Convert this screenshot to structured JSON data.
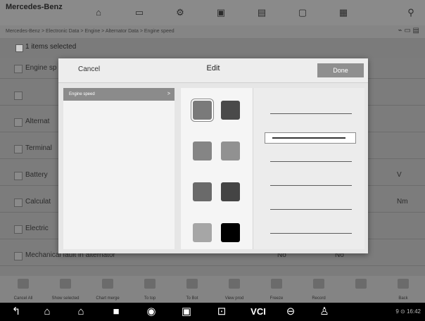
{
  "app": {
    "brand": "Mercedes-Benz",
    "sub": ""
  },
  "breadcrumb": "Mercedes-Benz > Electronic Data > Engine > Alternator Data > Engine speed",
  "selection": {
    "label": "1 items selected"
  },
  "background_rows": [
    {
      "name": "Engine sp",
      "v1": "",
      "v2": "",
      "unit": ""
    },
    {
      "name": "",
      "v1": "",
      "v2": "",
      "unit": ""
    },
    {
      "name": "Alternat",
      "v1": "",
      "v2": "",
      "unit": ""
    },
    {
      "name": "Terminal",
      "v1": "",
      "v2": "",
      "unit": ""
    },
    {
      "name": "Battery",
      "v1": "",
      "v2": "",
      "unit": "V"
    },
    {
      "name": "Calculat",
      "v1": "",
      "v2": "",
      "unit": "Nm"
    },
    {
      "name": "Electric",
      "v1": "",
      "v2": "",
      "unit": ""
    },
    {
      "name": "Mechanical fault in alternator",
      "v1": "No",
      "v2": "No",
      "unit": ""
    }
  ],
  "toolbar": [
    {
      "label": "Cancel All"
    },
    {
      "label": "Show selected"
    },
    {
      "label": "Chart merge"
    },
    {
      "label": "To top"
    },
    {
      "label": "To Bot"
    },
    {
      "label": "View prod"
    },
    {
      "label": "Freeze"
    },
    {
      "label": "Record"
    },
    {
      "label": ""
    },
    {
      "label": "Back"
    }
  ],
  "status": {
    "clock": "9 ⊙ 16:42"
  },
  "modal": {
    "title": "Edit",
    "cancel_label": "Cancel",
    "done_label": "Done",
    "items": [
      {
        "label": "Engine speed",
        "arrow": ">"
      }
    ],
    "swatches": [
      {
        "color": "#7a7a7a",
        "selected": true
      },
      {
        "color": "#4a4a4a",
        "selected": false
      },
      {
        "color": "#858585",
        "selected": false
      },
      {
        "color": "#919191",
        "selected": false
      },
      {
        "color": "#6a6a6a",
        "selected": false
      },
      {
        "color": "#444444",
        "selected": false
      },
      {
        "color": "#a6a6a6",
        "selected": false
      },
      {
        "color": "#000000",
        "selected": false
      }
    ],
    "line_styles": [
      {
        "style": "thin",
        "selected": false
      },
      {
        "style": "thick",
        "selected": true
      },
      {
        "style": "thin",
        "selected": false
      },
      {
        "style": "thin",
        "selected": false
      },
      {
        "style": "thin",
        "selected": false
      },
      {
        "style": "thin",
        "selected": false
      }
    ]
  },
  "colors": {
    "overlay": "#7c7c7c",
    "done_button": "#8f8f8f",
    "selected_item": "#8b8b8b"
  }
}
